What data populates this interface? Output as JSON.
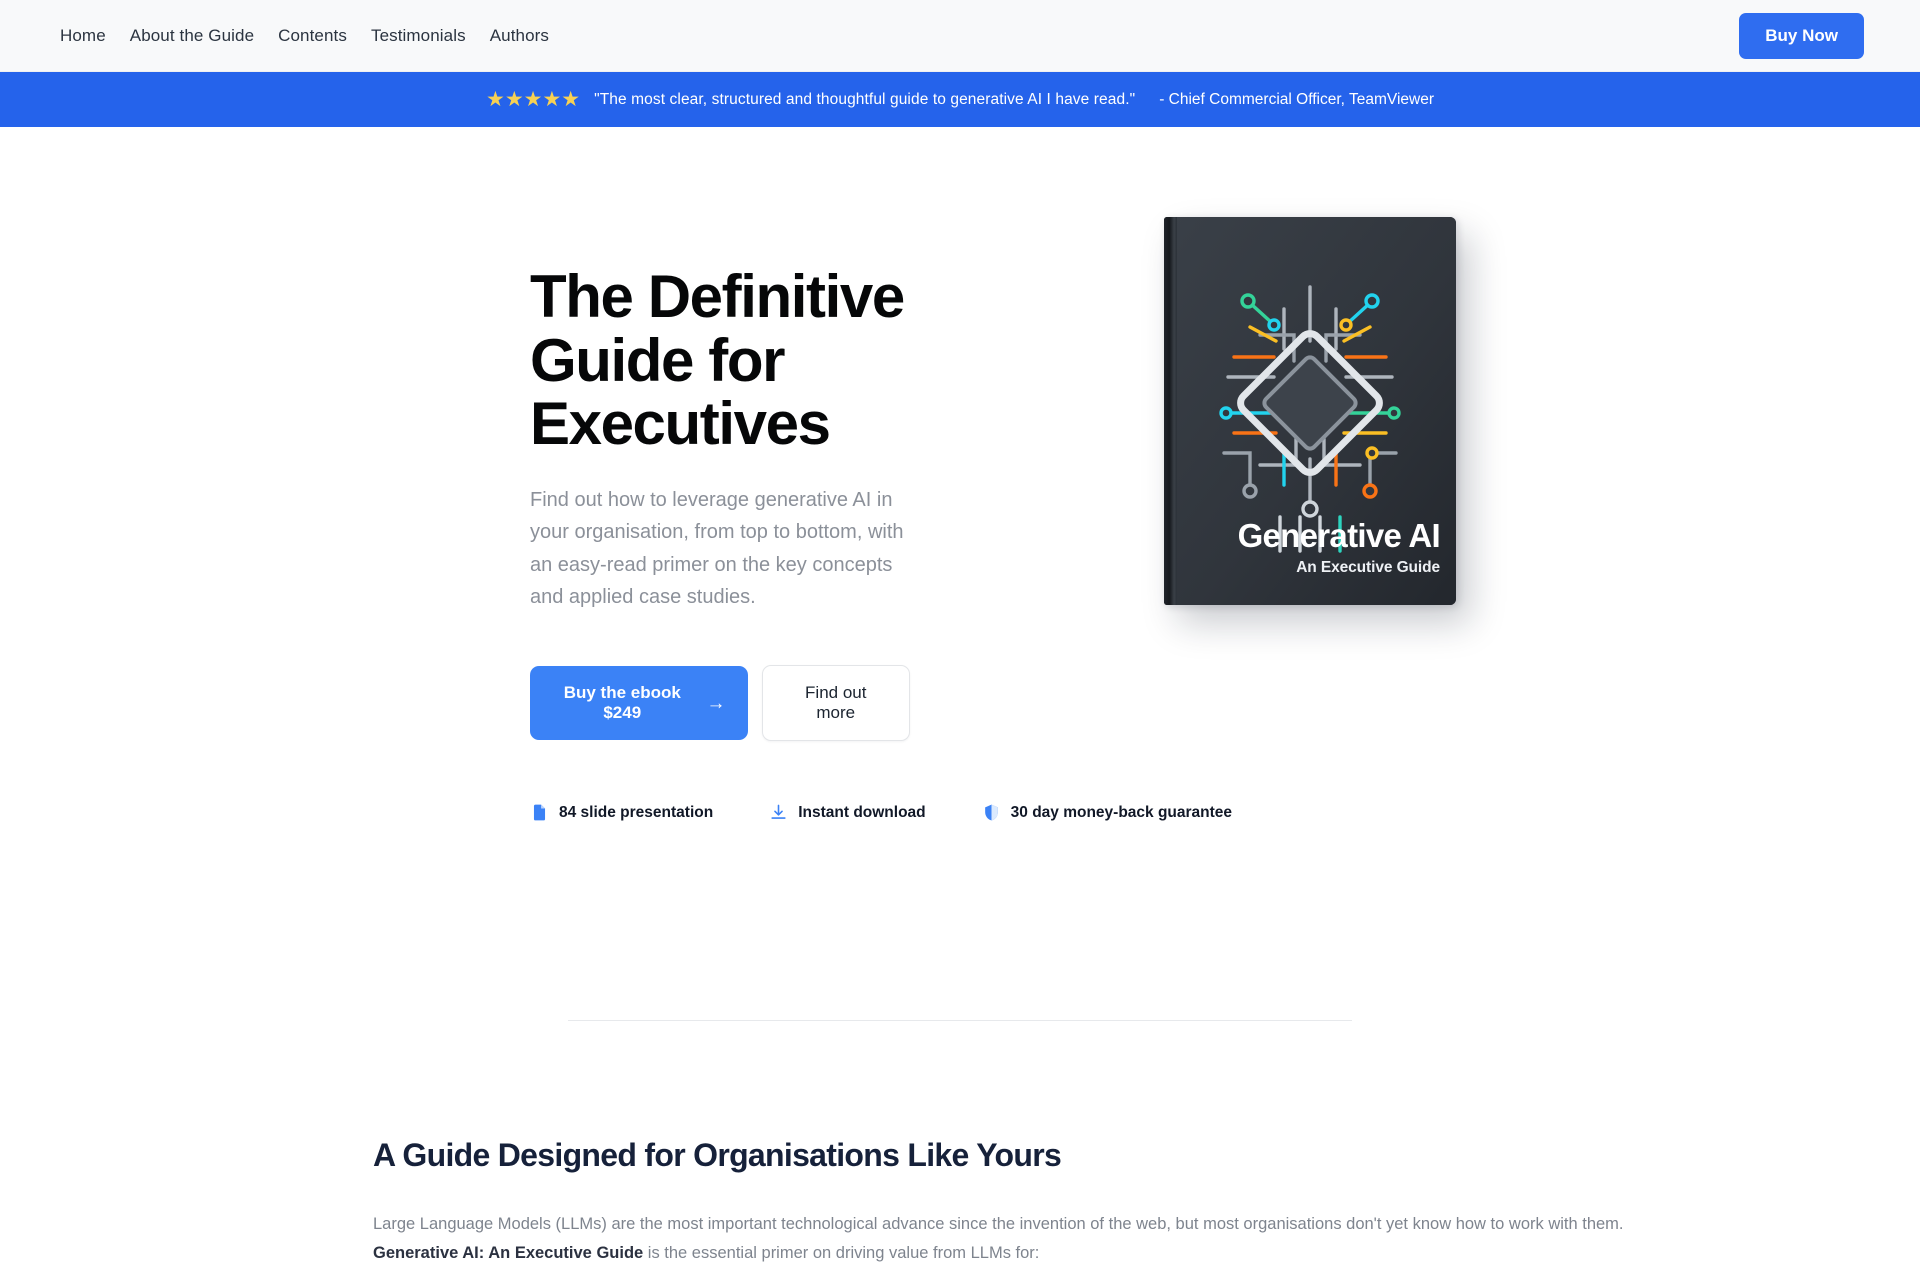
{
  "nav": {
    "links": [
      {
        "label": "Home"
      },
      {
        "label": "About the Guide"
      },
      {
        "label": "Contents"
      },
      {
        "label": "Testimonials"
      },
      {
        "label": "Authors"
      }
    ],
    "cta_label": "Buy Now"
  },
  "review_banner": {
    "stars": "★★★★★",
    "star_count": 5,
    "quote": "\"The most clear, structured and thoughtful guide to generative AI I have read.\"",
    "author": "- Chief Commercial Officer, TeamViewer",
    "background_color": "#2563eb",
    "star_color": "#f7d154"
  },
  "hero": {
    "title": "The Definitive Guide for Executives",
    "subtitle": "Find out how to leverage generative AI in your organisation, from top to bottom, with an easy-read primer on the key concepts and applied case studies.",
    "primary_cta": {
      "label": "Buy the ebook $249",
      "arrow": "→",
      "color": "#3b82f6"
    },
    "secondary_cta": {
      "label": "Find out more"
    },
    "features": [
      {
        "icon": "file-presentation-icon",
        "label": "84 slide presentation"
      },
      {
        "icon": "download-icon",
        "label": "Instant download"
      },
      {
        "icon": "shield-icon",
        "label": "30 day money-back guarantee"
      }
    ],
    "book": {
      "title": "Generative AI",
      "subtitle": "An Executive Guide",
      "cover_color": "#32373e",
      "accent_colors": [
        "#2dd4a7",
        "#22d3ee",
        "#f97316",
        "#fbbf24",
        "#9ca3af"
      ]
    }
  },
  "section": {
    "title": "A Guide Designed for Organisations Like Yours",
    "body_part1": "Large Language Models (LLMs) are the most important technological advance since the invention of the web, but most organisations don't yet know how to work with them. ",
    "body_strong1": "Generative AI: An Executive Guide",
    "body_part2": " is the essential primer on driving value from LLMs for:"
  }
}
